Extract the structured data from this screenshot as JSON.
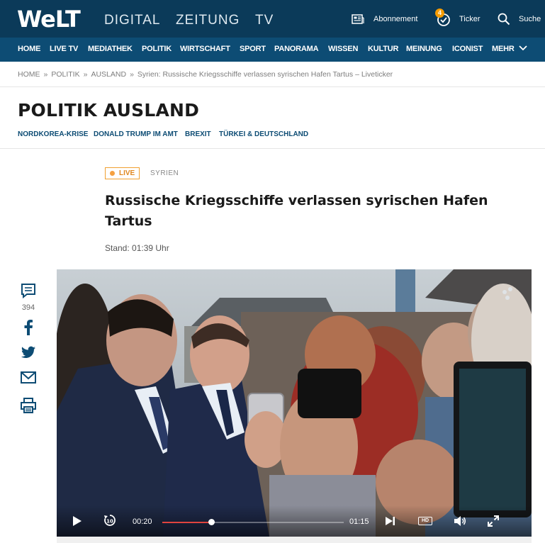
{
  "header": {
    "logo": "WeLT",
    "nav": [
      "DIGITAL",
      "ZEITUNG",
      "TV"
    ],
    "abonnement_label": "Abonnement",
    "ticker_label": "Ticker",
    "ticker_count": "4",
    "search_label": "Suche"
  },
  "main_nav": [
    "HOME",
    "LIVE TV",
    "MEDIATHEK",
    "POLITIK",
    "WIRTSCHAFT",
    "SPORT",
    "PANORAMA",
    "WISSEN",
    "KULTUR",
    "MEINUNG",
    "ICONIST",
    "MEHR"
  ],
  "breadcrumb": [
    "HOME",
    "POLITIK",
    "AUSLAND",
    "Syrien: Russische Kriegsschiffe verlassen syrischen Hafen Tartus – Liveticker"
  ],
  "section": {
    "title": "POLITIK AUSLAND",
    "subnav": [
      "NORDKOREA-KRISE",
      "DONALD TRUMP IM AMT",
      "BREXIT",
      "TÜRKEI & DEUTSCHLAND"
    ]
  },
  "article": {
    "live_label": "LIVE",
    "topic": "SYRIEN",
    "headline": "Russische Kriegsschiffe verlassen syrischen Hafen Tartus",
    "stand": "Stand: 01:39 Uhr"
  },
  "share": {
    "comment_count": "394",
    "icons": [
      "comment-icon",
      "facebook-icon",
      "twitter-icon",
      "mail-icon",
      "print-icon"
    ]
  },
  "video": {
    "current_time": "00:20",
    "duration": "01:15",
    "progress_fraction": 0.27,
    "hd_label": "HD",
    "icons": [
      "play-icon",
      "replay-10-icon",
      "next-icon",
      "volume-icon",
      "fullscreen-icon"
    ]
  },
  "colors": {
    "header_bg": "#0b3a59",
    "nav_bg": "#0d4c74",
    "live_accent": "#f0a030",
    "progress_fill": "#e0443e"
  }
}
